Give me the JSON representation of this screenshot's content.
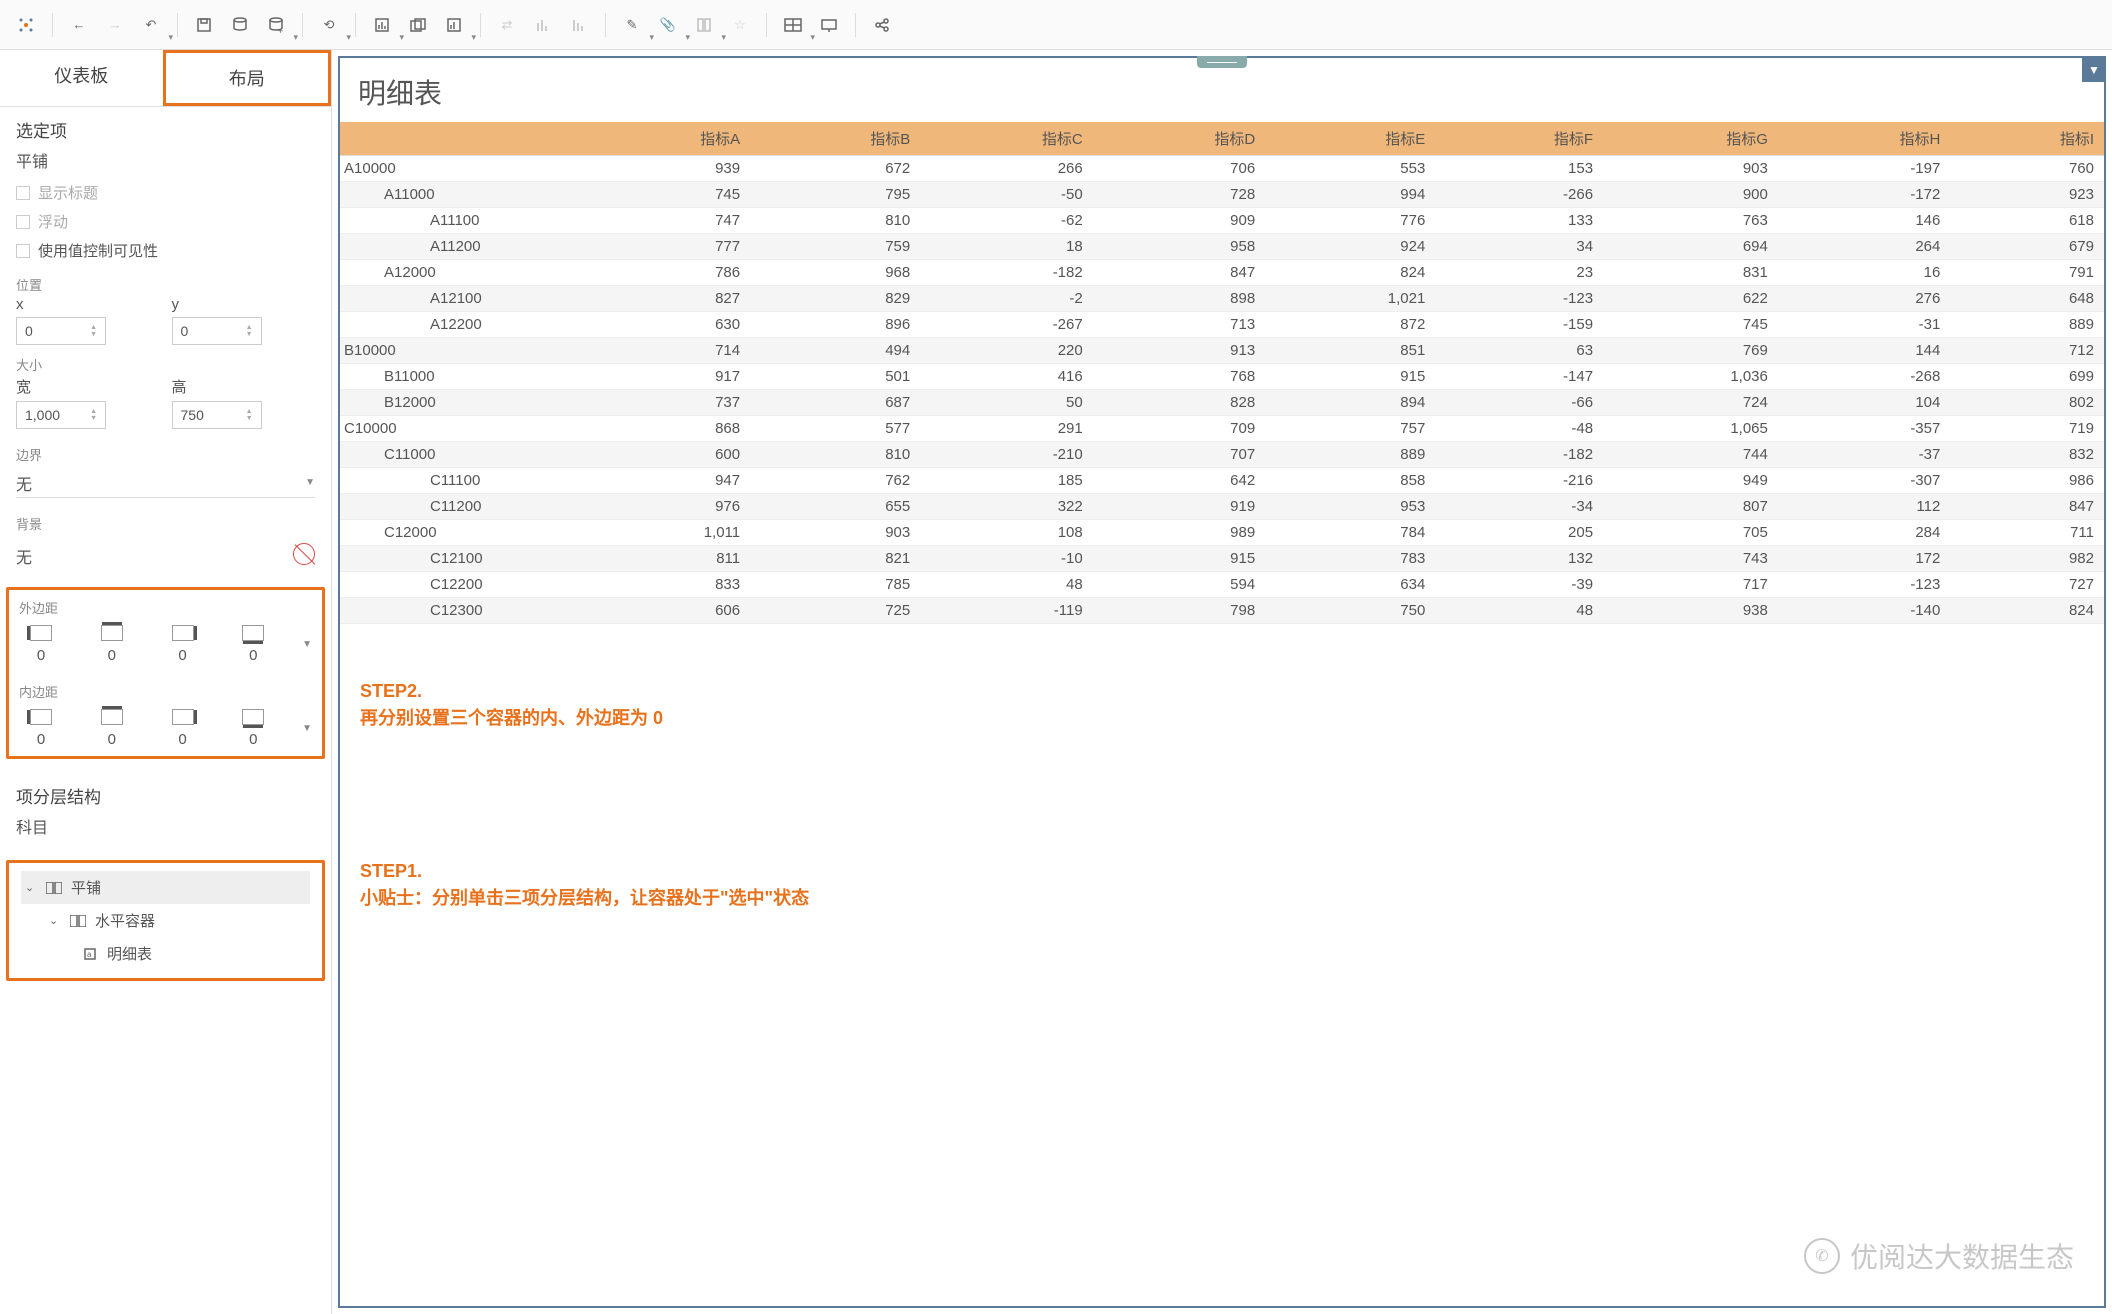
{
  "sidebar": {
    "tabs": {
      "dashboard": "仪表板",
      "layout": "布局"
    },
    "selected_section": "选定项",
    "tile_label": "平铺",
    "chk_show_title": "显示标题",
    "chk_float": "浮动",
    "chk_visibility": "使用值控制可见性",
    "position_label": "位置",
    "x_label": "x",
    "y_label": "y",
    "x_val": "0",
    "y_val": "0",
    "size_label": "大小",
    "w_label": "宽",
    "h_label": "高",
    "w_val": "1,000",
    "h_val": "750",
    "border_label": "边界",
    "border_val": "无",
    "bg_label": "背景",
    "bg_val": "无",
    "outer_margin_label": "外边距",
    "inner_margin_label": "内边距",
    "margin_vals": [
      "0",
      "0",
      "0",
      "0"
    ],
    "hierarchy_label": "项分层结构",
    "subject_label": "科目",
    "tree": {
      "tile": "平铺",
      "hcontainer": "水平容器",
      "detail": "明细表"
    }
  },
  "sheet": {
    "title": "明细表",
    "columns": [
      "",
      "指标A",
      "指标B",
      "指标C",
      "指标D",
      "指标E",
      "指标F",
      "指标G",
      "指标H",
      "指标I"
    ],
    "rows": [
      {
        "lvl": 0,
        "label": "A10000",
        "v": [
          "939",
          "672",
          "266",
          "706",
          "553",
          "153",
          "903",
          "-197",
          "760"
        ]
      },
      {
        "lvl": 1,
        "label": "A11000",
        "v": [
          "745",
          "795",
          "-50",
          "728",
          "994",
          "-266",
          "900",
          "-172",
          "923"
        ]
      },
      {
        "lvl": 2,
        "label": "A11100",
        "v": [
          "747",
          "810",
          "-62",
          "909",
          "776",
          "133",
          "763",
          "146",
          "618"
        ]
      },
      {
        "lvl": 2,
        "label": "A11200",
        "v": [
          "777",
          "759",
          "18",
          "958",
          "924",
          "34",
          "694",
          "264",
          "679"
        ]
      },
      {
        "lvl": 1,
        "label": "A12000",
        "v": [
          "786",
          "968",
          "-182",
          "847",
          "824",
          "23",
          "831",
          "16",
          "791"
        ]
      },
      {
        "lvl": 2,
        "label": "A12100",
        "v": [
          "827",
          "829",
          "-2",
          "898",
          "1,021",
          "-123",
          "622",
          "276",
          "648"
        ]
      },
      {
        "lvl": 2,
        "label": "A12200",
        "v": [
          "630",
          "896",
          "-267",
          "713",
          "872",
          "-159",
          "745",
          "-31",
          "889"
        ]
      },
      {
        "lvl": 0,
        "label": "B10000",
        "v": [
          "714",
          "494",
          "220",
          "913",
          "851",
          "63",
          "769",
          "144",
          "712"
        ]
      },
      {
        "lvl": 1,
        "label": "B11000",
        "v": [
          "917",
          "501",
          "416",
          "768",
          "915",
          "-147",
          "1,036",
          "-268",
          "699"
        ]
      },
      {
        "lvl": 1,
        "label": "B12000",
        "v": [
          "737",
          "687",
          "50",
          "828",
          "894",
          "-66",
          "724",
          "104",
          "802"
        ]
      },
      {
        "lvl": 0,
        "label": "C10000",
        "v": [
          "868",
          "577",
          "291",
          "709",
          "757",
          "-48",
          "1,065",
          "-357",
          "719"
        ]
      },
      {
        "lvl": 1,
        "label": "C11000",
        "v": [
          "600",
          "810",
          "-210",
          "707",
          "889",
          "-182",
          "744",
          "-37",
          "832"
        ]
      },
      {
        "lvl": 2,
        "label": "C11100",
        "v": [
          "947",
          "762",
          "185",
          "642",
          "858",
          "-216",
          "949",
          "-307",
          "986"
        ]
      },
      {
        "lvl": 2,
        "label": "C11200",
        "v": [
          "976",
          "655",
          "322",
          "919",
          "953",
          "-34",
          "807",
          "112",
          "847"
        ]
      },
      {
        "lvl": 1,
        "label": "C12000",
        "v": [
          "1,011",
          "903",
          "108",
          "989",
          "784",
          "205",
          "705",
          "284",
          "711"
        ]
      },
      {
        "lvl": 2,
        "label": "C12100",
        "v": [
          "811",
          "821",
          "-10",
          "915",
          "783",
          "132",
          "743",
          "172",
          "982"
        ]
      },
      {
        "lvl": 2,
        "label": "C12200",
        "v": [
          "833",
          "785",
          "48",
          "594",
          "634",
          "-39",
          "717",
          "-123",
          "727"
        ]
      },
      {
        "lvl": 2,
        "label": "C12300",
        "v": [
          "606",
          "725",
          "-119",
          "798",
          "750",
          "48",
          "938",
          "-140",
          "824"
        ]
      }
    ]
  },
  "annotations": {
    "step2_title": "STEP2.",
    "step2_text": "再分别设置三个容器的内、外边距为 0",
    "step1_title": "STEP1.",
    "step1_text": "小贴士：分别单击三项分层结构，让容器处于\"选中\"状态"
  },
  "watermark": "优阅达大数据生态"
}
